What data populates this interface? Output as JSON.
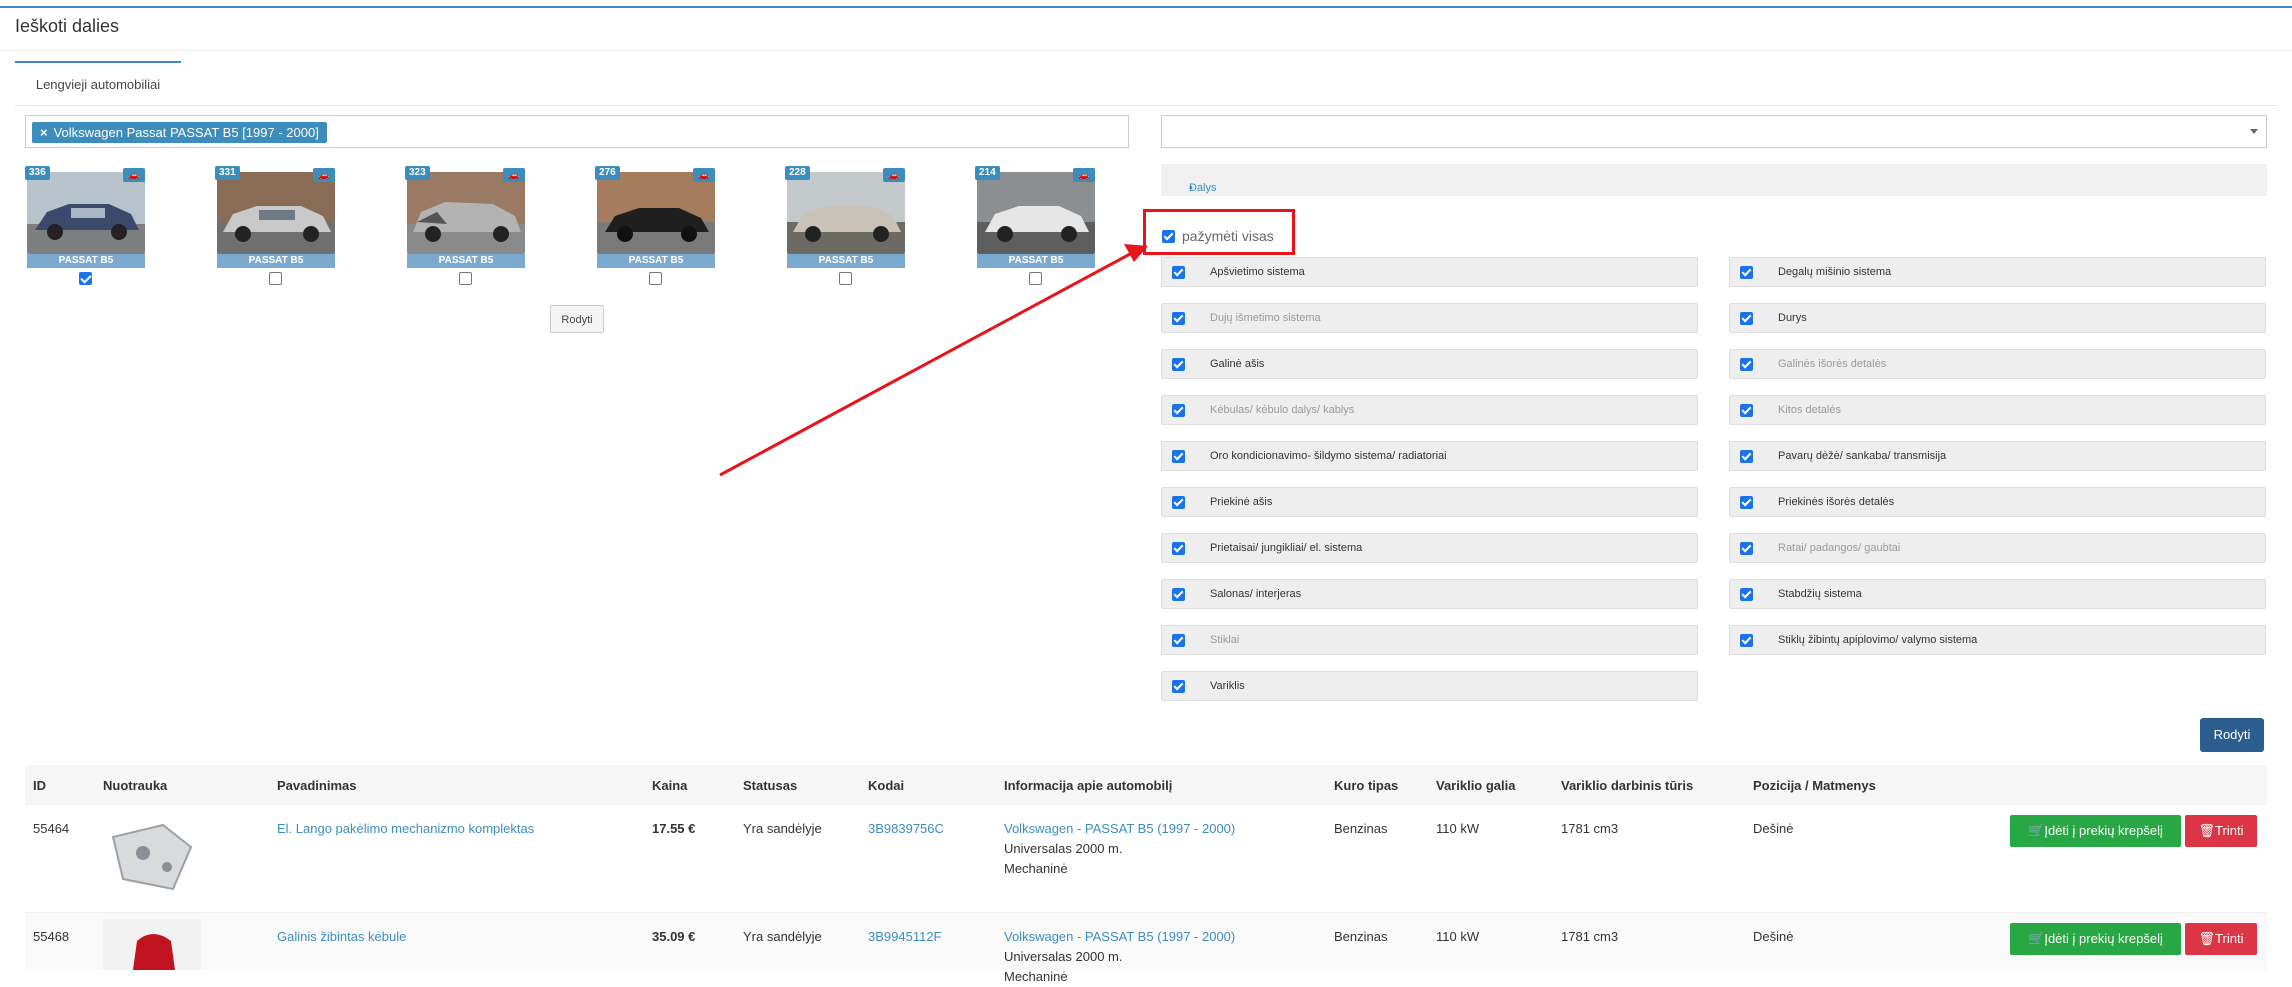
{
  "page": {
    "title": "Ieškoti dalies"
  },
  "tabs": [
    {
      "label": "Lengvieji automobiliai",
      "active": true
    }
  ],
  "model_filter": {
    "selected_tag": "Volkswagen Passat PASSAT B5 [1997 - 2000]",
    "remove_symbol": "×"
  },
  "cars": [
    {
      "count": "336",
      "label": "PASSAT B5",
      "checked": true,
      "car_color": "#3a4a6b"
    },
    {
      "count": "331",
      "label": "PASSAT B5",
      "checked": false,
      "car_color": "#c9c9c9"
    },
    {
      "count": "323",
      "label": "PASSAT B5",
      "checked": false,
      "car_color": "#b3b3b3"
    },
    {
      "count": "276",
      "label": "PASSAT B5",
      "checked": false,
      "car_color": "#1f1f1f"
    },
    {
      "count": "228",
      "label": "PASSAT B5",
      "checked": false,
      "car_color": "#c8c3b6"
    },
    {
      "count": "214",
      "label": "PASSAT B5",
      "checked": false,
      "car_color": "#e6e6e6"
    }
  ],
  "show_small_button": "Rodyti",
  "parts_filter": {
    "value": "",
    "dalys_label": "Dalys"
  },
  "select_all": {
    "label": "pažymėti visas",
    "checked": true
  },
  "categories": [
    {
      "label": "Apšvietimo sistema",
      "dim": false
    },
    {
      "label": "Degalų mišinio sistema",
      "dim": false
    },
    {
      "label": "Dujų išmetimo sistema",
      "dim": true
    },
    {
      "label": "Durys",
      "dim": false
    },
    {
      "label": "Galinė ašis",
      "dim": false
    },
    {
      "label": "Galinės išorės detalės",
      "dim": true
    },
    {
      "label": "Kėbulas/ kėbulo dalys/ kablys",
      "dim": true
    },
    {
      "label": "Kitos detalės",
      "dim": true
    },
    {
      "label": "Oro kondicionavimo- šildymo sistema/ radiatoriai",
      "dim": false
    },
    {
      "label": "Pavarų dėžė/ sankaba/ transmisija",
      "dim": false
    },
    {
      "label": "Priekinė ašis",
      "dim": false
    },
    {
      "label": "Priekinės išorės detalės",
      "dim": false
    },
    {
      "label": "Prietaisai/ jungikliai/ el. sistema",
      "dim": false
    },
    {
      "label": "Ratai/ padangos/ gaubtai",
      "dim": true
    },
    {
      "label": "Salonas/ interjeras",
      "dim": false
    },
    {
      "label": "Stabdžių sistema",
      "dim": false
    },
    {
      "label": "Stiklai",
      "dim": true
    },
    {
      "label": "Stiklų žibintų apiplovimo/ valymo sistema",
      "dim": false
    },
    {
      "label": "Variklis",
      "dim": false
    }
  ],
  "show_button": "Rodyti",
  "table": {
    "headers": [
      "ID",
      "Nuotrauka",
      "Pavadinimas",
      "Kaina",
      "Statusas",
      "Kodai",
      "Informacija apie automobilį",
      "Kuro tipas",
      "Variklio galia",
      "Variklio darbinis tūris",
      "Pozicija / Matmenys"
    ],
    "rows": [
      {
        "id": "55464",
        "name": "El. Lango pakėlimo mechanizmo komplektas",
        "price": "17.55 €",
        "status": "Yra sandėlyje",
        "code": "3B9839756C",
        "car_link": "Volkswagen - PASSAT B5 (1997 - 2000)",
        "car_line2": "Universalas 2000 m.",
        "car_line3": "Mechaninė",
        "fuel": "Benzinas",
        "power": "110 kW",
        "volume": "1781 cm3",
        "position": "Dešinė",
        "add_btn": "Įdėti į prekių krepšelį",
        "delete_btn": "Trinti"
      },
      {
        "id": "55468",
        "name": "Galinis žibintas kėbule",
        "price": "35.09 €",
        "status": "Yra sandėlyje",
        "code": "3B9945112F",
        "car_link": "Volkswagen - PASSAT B5 (1997 - 2000)",
        "car_line2": "Universalas 2000 m.",
        "car_line3": "Mechaninė",
        "fuel": "Benzinas",
        "power": "110 kW",
        "volume": "1781 cm3",
        "position": "Dešinė",
        "add_btn": "Įdėti į prekių krepšelį",
        "delete_btn": "Trinti"
      }
    ]
  },
  "colors": {
    "accent": "#3c8dbc",
    "annotation_red": "#e8141a",
    "green": "#28a745",
    "red": "#dc3545",
    "primary_dark": "#2b5e8e"
  }
}
